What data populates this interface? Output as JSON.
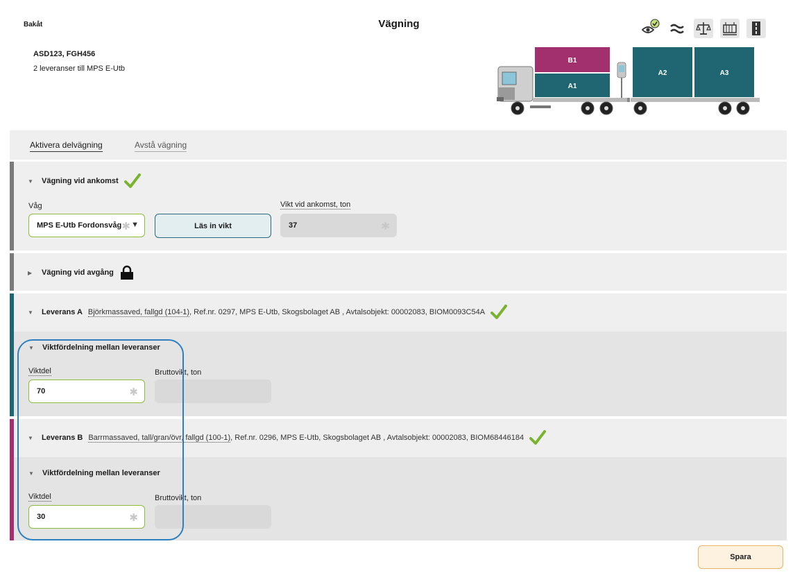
{
  "header": {
    "back_label": "Bakåt",
    "title": "Vägning"
  },
  "toolbar": {
    "icons": [
      "eye-check-icon",
      "approx-icon",
      "scale-icon",
      "container-icon",
      "road-icon"
    ]
  },
  "vehicle": {
    "id": "ASD123, FGH456",
    "subtitle": "2 leveranser till MPS E-Utb",
    "load_labels": {
      "b1": "B1",
      "a1": "A1",
      "a2": "A2",
      "a3": "A3"
    }
  },
  "tabs": {
    "active": "Aktivera delvägning",
    "inactive": "Avstå vägning"
  },
  "arrival": {
    "heading": "Vägning vid ankomst",
    "scale_label": "Våg",
    "scale_value": "MPS E-Utb Fordonsvåg",
    "read_button": "Läs in vikt",
    "weight_label": "Vikt vid ankomst, ton",
    "weight_value": "37"
  },
  "departure": {
    "heading": "Vägning vid avgång"
  },
  "delivery_a": {
    "label": "Leverans A",
    "assortment": "Björkmassaved, fallgd (104-1)",
    "details": ", Ref.nr. 0297, MPS E-Utb, Skogsbolaget AB , Avtalsobjekt: 00002083, BIOM0093C54A",
    "split_heading": "Viktfördelning mellan leveranser",
    "share_label": "Viktdel",
    "share_value": "70",
    "gross_label": "Bruttovikt, ton",
    "gross_value": ""
  },
  "delivery_b": {
    "label": "Leverans B",
    "assortment": "Barrmassaved, tall/gran/övr, fallgd (100-1)",
    "details": ", Ref.nr. 0296, MPS E-Utb, Skogsbolaget AB , Avtalsobjekt: 00002083, BIOM68446184",
    "split_heading": "Viktfördelning mellan leveranser",
    "share_label": "Viktdel",
    "share_value": "30",
    "gross_label": "Bruttovikt, ton",
    "gross_value": ""
  },
  "footer": {
    "save_label": "Spara"
  },
  "colors": {
    "delivery_a": "#1f6672",
    "delivery_b": "#a3306e",
    "stripe_grey": "#7a7a7a",
    "check_green": "#7bb230",
    "highlight_blue": "#2e7fbf"
  }
}
